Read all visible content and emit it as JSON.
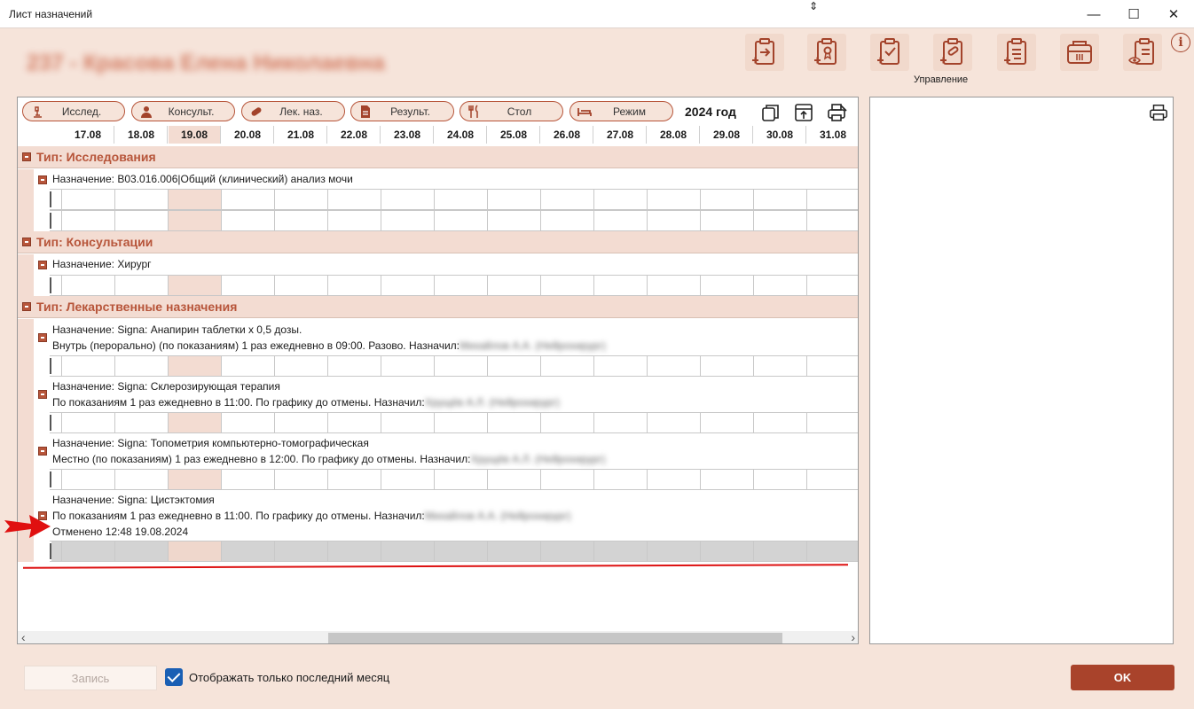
{
  "window": {
    "title": "Лист назначений",
    "minimize": "—",
    "maximize": "☐",
    "close": "✕"
  },
  "patient_name": "237 - Красова Елена Николаевна",
  "toolbar": {
    "group_label": "Управление"
  },
  "filters": [
    {
      "label": "Исслед."
    },
    {
      "label": "Консульт."
    },
    {
      "label": "Лек. наз."
    },
    {
      "label": "Результ."
    },
    {
      "label": "Стол"
    },
    {
      "label": "Режим"
    }
  ],
  "year_label": "2024 год",
  "dates": [
    "17.08",
    "18.08",
    "19.08",
    "20.08",
    "21.08",
    "22.08",
    "23.08",
    "24.08",
    "25.08",
    "26.08",
    "27.08",
    "28.08",
    "29.08",
    "30.08",
    "31.08"
  ],
  "selected_date": "19.08",
  "sections": {
    "research": {
      "title": "Тип: Исследования",
      "item1": "Назначение: B03.016.006|Общий (клинический) анализ мочи"
    },
    "consult": {
      "title": "Тип: Консультации",
      "item1": "Назначение: Хирург"
    },
    "meds": {
      "title": "Тип: Лекарственные назначения",
      "item1": {
        "line1": "Назначение: Signa: Анапирин таблетки х 0,5 дозы.",
        "line2": "Внутрь (перорально) (по показаниям) 1 раз ежедневно в 09:00. Разово. Назначил:",
        "doctor": "Михайлов А.А. (Нейрохирург)"
      },
      "item2": {
        "line1": "Назначение: Signa: Склерозирующая терапия",
        "line2": "По показаниям 1 раз ежедневно в 11:00. По графику до отмены. Назначил:",
        "doctor": "Хрущёв А.Л. (Нейрохирург)"
      },
      "item3": {
        "line1": "Назначение: Signa: Топометрия компьютерно-томографическая",
        "line2": "Местно (по показаниям) 1 раз ежедневно в 12:00. По графику до отмены. Назначил:",
        "doctor": "Хрущёв А.Л. (Нейрохирург)"
      },
      "item4": {
        "line1": "Назначение: Signa: Цистэктомия",
        "line2": "По показаниям 1 раз ежедневно в 11:00. По графику до отмены. Назначил:",
        "doctor": "Михайлов А.А. (Нейрохирург)",
        "line3": "Отменено 12:48 19.08.2024"
      }
    }
  },
  "scroll": {
    "left": "‹",
    "right": "›"
  },
  "footer": {
    "save_label": "Запись",
    "checkbox_label": "Отображать только последний месяц",
    "checkbox_checked": true,
    "ok_label": "OK"
  },
  "colors": {
    "accent": "#a9432b",
    "background": "#f6e4da",
    "section_bg": "#f3dcd2"
  }
}
